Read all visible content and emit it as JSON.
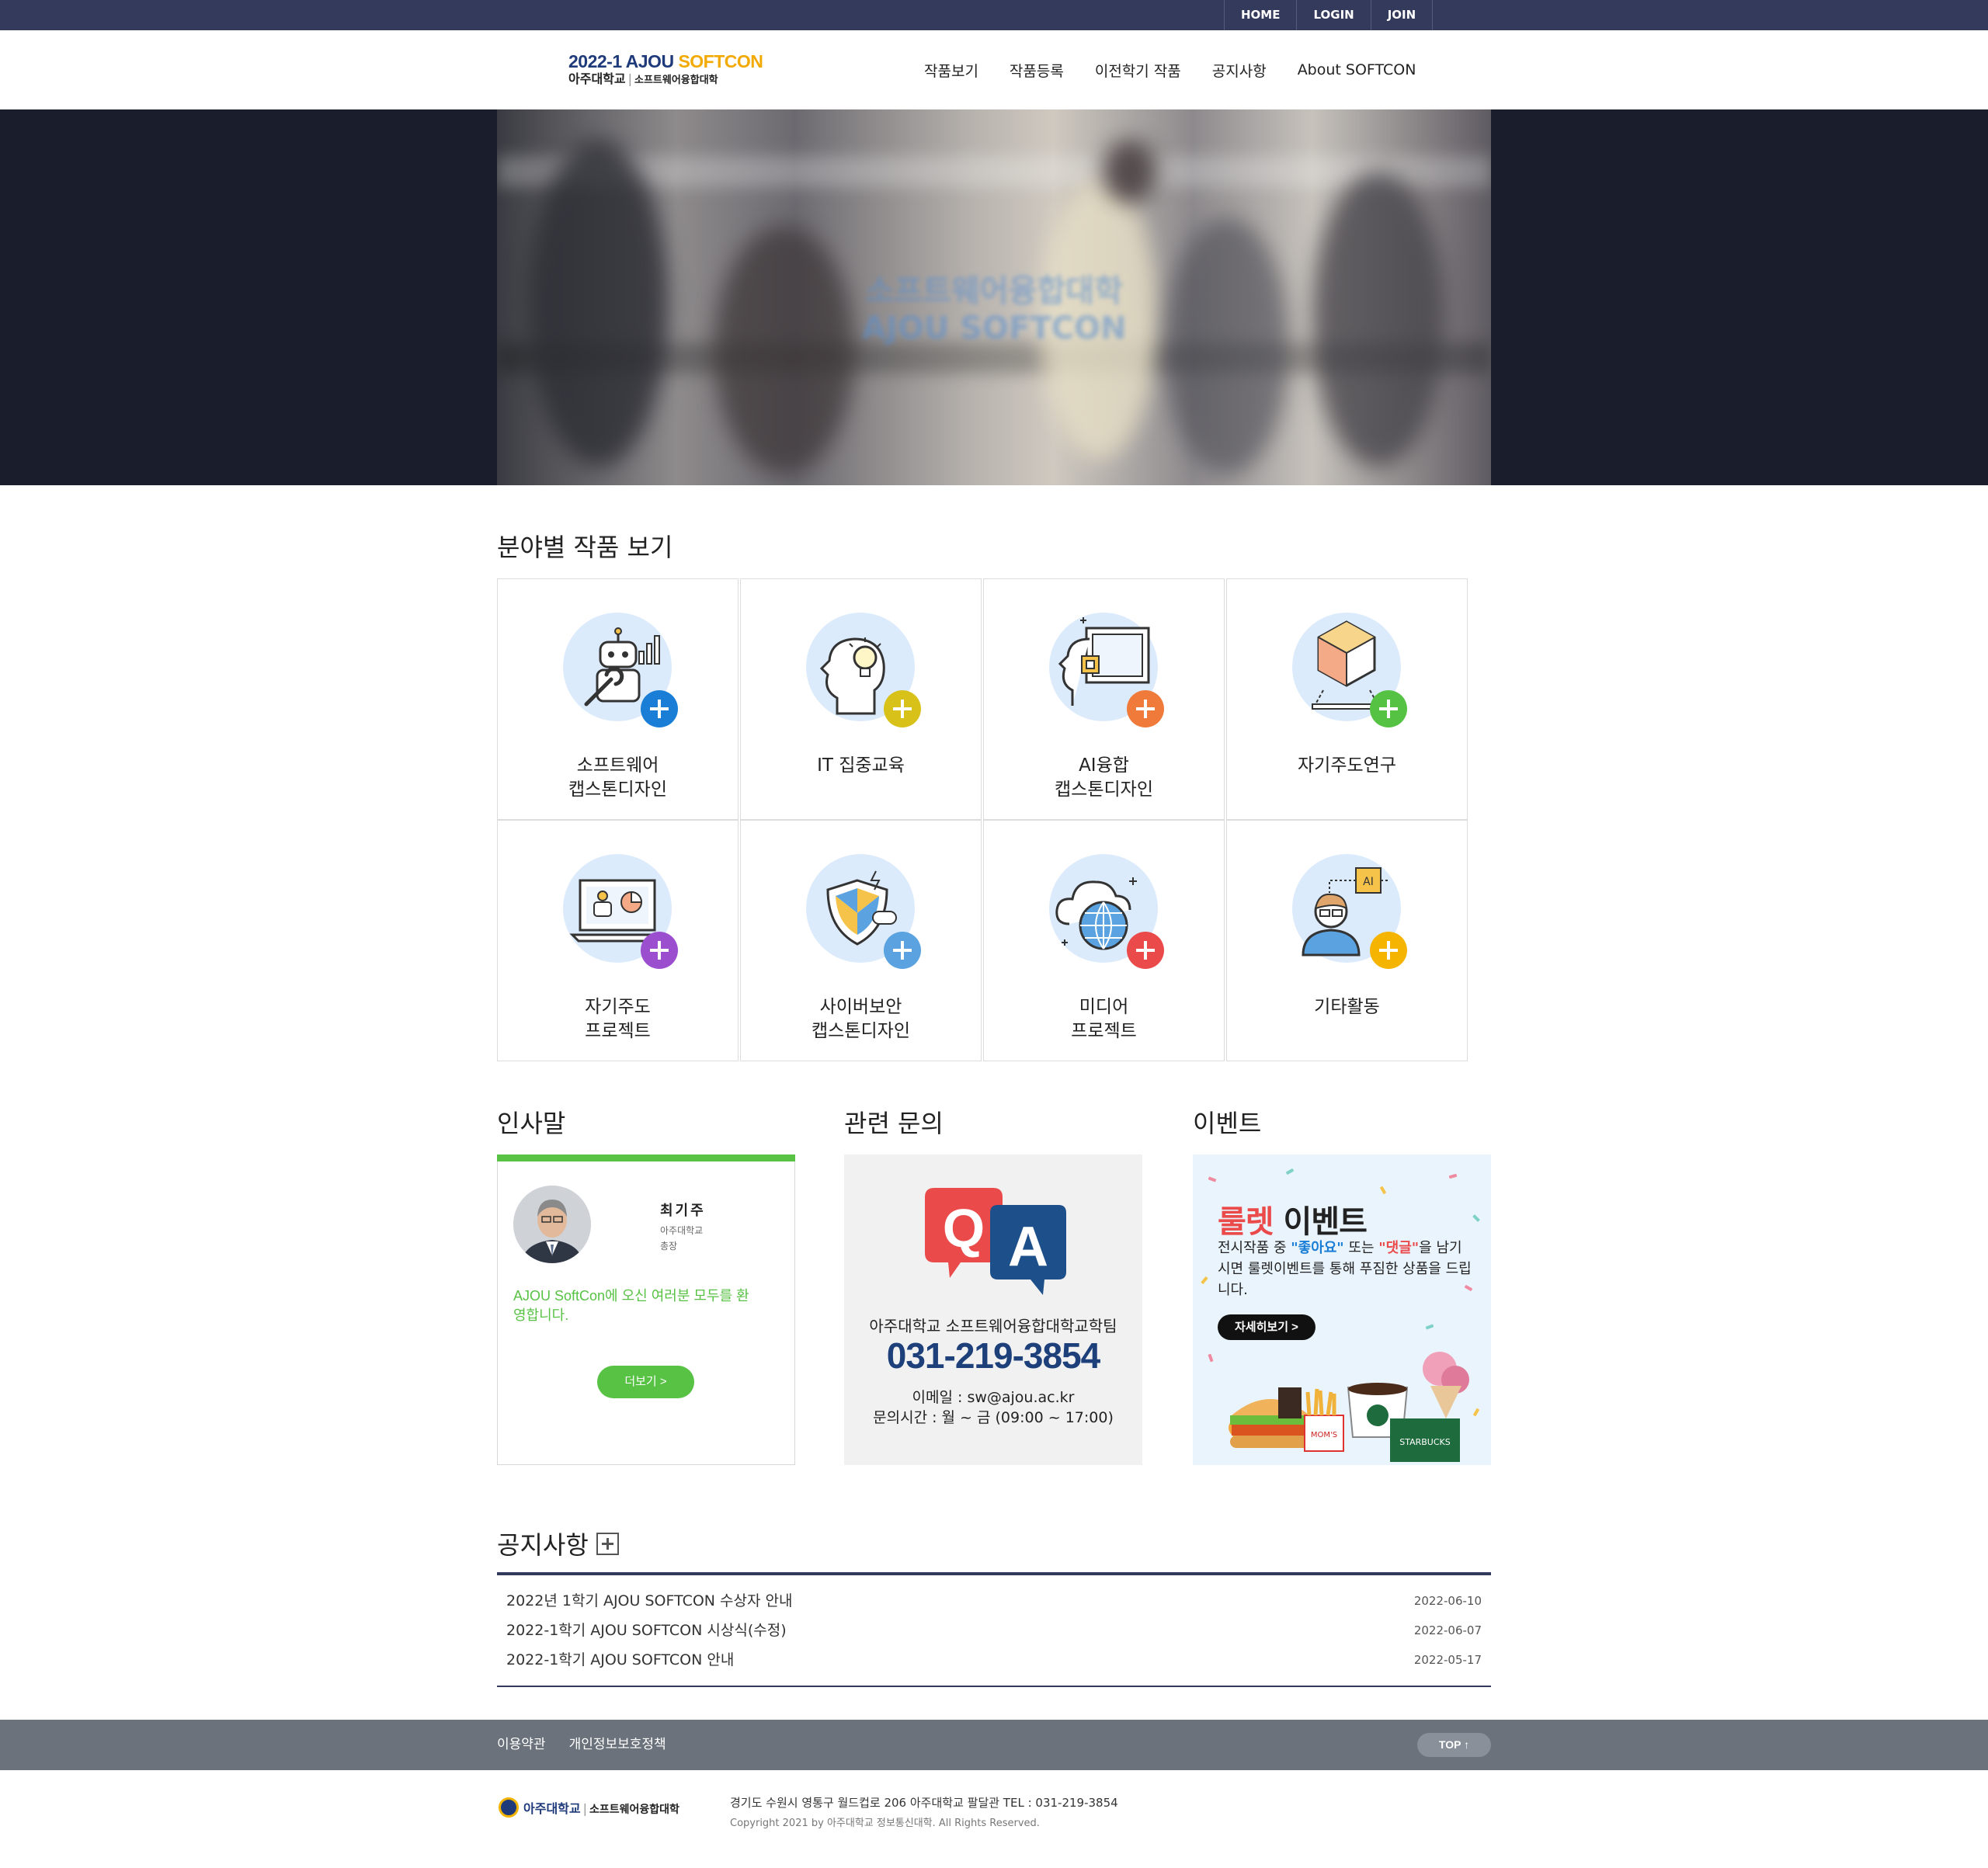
{
  "topbar": {
    "links": [
      "HOME",
      "LOGIN",
      "JOIN"
    ]
  },
  "header": {
    "logo_line1_a": "2022-1 AJOU ",
    "logo_line1_b": "SOFTCON",
    "logo_univ": "아주대학교",
    "logo_college": "소프트웨어융합대학",
    "nav": [
      "작품보기",
      "작품등록",
      "이전학기 작품",
      "공지사항",
      "About SOFTCON"
    ]
  },
  "hero": {
    "caption_line1": "소프트웨어융합대학",
    "caption_line2": "AJOU SOFTCON"
  },
  "categories_title": "분야별 작품 보기",
  "categories": [
    {
      "label": "소프트웨어\n캡스톤디자인",
      "icon": "robot-wrench-icon",
      "accent": "#1a7ed6"
    },
    {
      "label": "IT 집중교육",
      "icon": "head-lightbulb-icon",
      "accent": "#d8c21a"
    },
    {
      "label": "AI융합\n캡스톤디자인",
      "icon": "ai-chip-head-icon",
      "accent": "#f07a3a"
    },
    {
      "label": "자기주도연구",
      "icon": "cube-research-icon",
      "accent": "#55c244"
    },
    {
      "label": "자기주도\n프로젝트",
      "icon": "laptop-robot-chart-icon",
      "accent": "#9b4fcf"
    },
    {
      "label": "사이버보안\n캡스톤디자인",
      "icon": "shield-security-icon",
      "accent": "#5aa3e0"
    },
    {
      "label": "미디어\n프로젝트",
      "icon": "cloud-globe-icon",
      "accent": "#ea4a4a"
    },
    {
      "label": "기타활동",
      "icon": "person-ai-chip-icon",
      "accent": "#f5b400"
    }
  ],
  "greeting": {
    "title": "인사말",
    "name": "최기주",
    "affiliation_1": "아주대학교",
    "affiliation_2": "총장",
    "message": "AJOU SoftCon에 오신 여러분 모두를 환영합니다.",
    "more_label": "더보기 >",
    "accent": "#57c244"
  },
  "contact": {
    "title": "관련 문의",
    "team": "아주대학교 소프트웨어융합대학교학팀",
    "phone": "031-219-3854",
    "email": "이메일 : sw@ajou.ac.kr",
    "hours": "문의시간 : 월 ~ 금 (09:00 ~ 17:00)"
  },
  "event": {
    "title": "이벤트",
    "heading_a": "룰렛",
    "heading_b": " 이벤트",
    "desc_1": "전시작품 중 ",
    "desc_like": "\"좋아요\"",
    "desc_2": " 또는 ",
    "desc_comment": "\"댓글\"",
    "desc_3": "을 남기시면 룰렛이벤트를 통해 푸짐한 상품을 드립니다.",
    "cta": "자세히보기 >",
    "brand_1": "MOM'S",
    "brand_2": "STARBUCKS"
  },
  "notices": {
    "title": "공지사항",
    "items": [
      {
        "title": "2022년 1학기 AJOU SOFTCON 수상자 안내",
        "date": "2022-06-10"
      },
      {
        "title": "2022-1학기 AJOU SOFTCON 시상식(수정)",
        "date": "2022-06-07"
      },
      {
        "title": "2022-1학기 AJOU SOFTCON 안내",
        "date": "2022-05-17"
      }
    ]
  },
  "footer": {
    "links": [
      "이용약관",
      "개인정보보호정책"
    ],
    "top_label": "TOP ↑",
    "logo_univ": "아주대학교",
    "logo_college": "소프트웨어융합대학",
    "address": "경기도 수원시 영통구 월드컵로 206 아주대학교 팔달관 TEL : 031-219-3854",
    "copyright": "Copyright 2021 by 아주대학교 정보통신대학. All Rights Reserved."
  }
}
